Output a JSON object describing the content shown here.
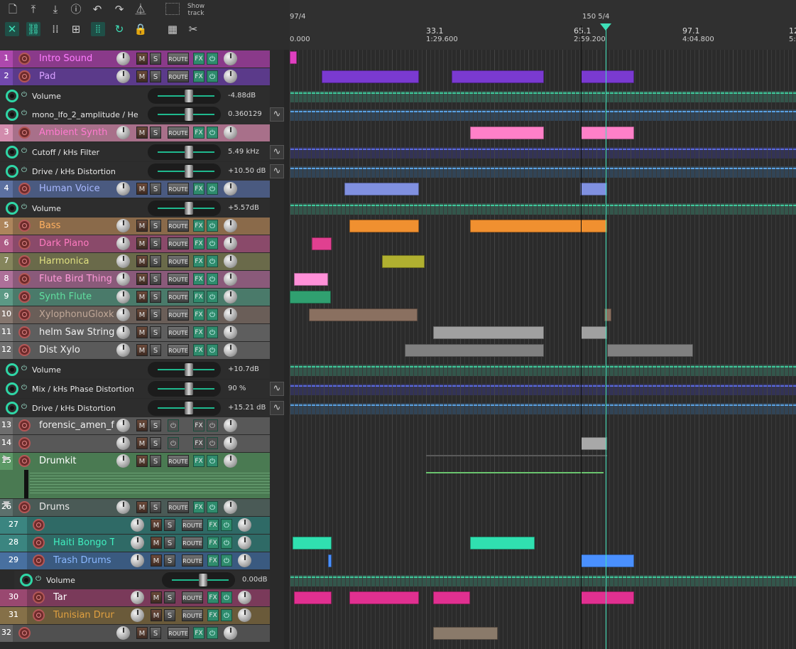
{
  "toolbar": {
    "show_track_label": "Show track",
    "icons": [
      "new-file",
      "save-upload",
      "download",
      "info",
      "undo",
      "redo",
      "metronome",
      "ripple",
      "link",
      "grid",
      "group",
      "grid-snap",
      "loop",
      "lock",
      "sequencer",
      "cut"
    ]
  },
  "ruler": {
    "start_label": "97/4",
    "start_time": "0.000",
    "markers": [
      {
        "bar": "33.1",
        "time": "1:29.600"
      },
      {
        "bar": "65.1",
        "time": "2:59.200"
      },
      {
        "bar": "97.1",
        "time": "4:04.800"
      },
      {
        "bar": "12",
        "time": "5:"
      }
    ],
    "tempo_marker": "150 5/4"
  },
  "buttons": {
    "mute": "M",
    "solo": "S",
    "route": "ROUTE",
    "fx": "FX",
    "power": "⏻"
  },
  "tracks": [
    {
      "num": "1",
      "name": "Intro Sound",
      "color": "#8a3a8a",
      "name_color": "#ff7dff"
    },
    {
      "num": "2",
      "name": "Pad",
      "color": "#5b3a8a",
      "name_color": "#d7a0ff"
    },
    {
      "num": "3",
      "name": "Ambient Synth",
      "color": "#a8708a",
      "name_color": "#ff7ad0"
    },
    {
      "num": "4",
      "name": "Human Voice",
      "color": "#4a5a80",
      "name_color": "#a8b8ff"
    },
    {
      "num": "5",
      "name": "Bass",
      "color": "#8a6a4a",
      "name_color": "#ffb060"
    },
    {
      "num": "6",
      "name": "Dark Piano",
      "color": "#8a4a6a",
      "name_color": "#ff7ac0"
    },
    {
      "num": "7",
      "name": "Harmonica",
      "color": "#6a6a4a",
      "name_color": "#e0e080"
    },
    {
      "num": "8",
      "name": "Flute Bird Thing",
      "color": "#8a5a7a",
      "name_color": "#ff9ad8"
    },
    {
      "num": "9",
      "name": "Synth Flute",
      "color": "#4a7a6a",
      "name_color": "#60e0a0"
    },
    {
      "num": "10",
      "name": "XylophonuGloxke",
      "color": "#6a5e58",
      "name_color": "#c0a898"
    },
    {
      "num": "11",
      "name": "helm Saw String",
      "color": "#5e5e5e",
      "name_color": "#f0f0f0"
    },
    {
      "num": "12",
      "name": "Dist Xylo",
      "color": "#5a5a5a",
      "name_color": "#f0f0f0"
    },
    {
      "num": "13",
      "name": "forensic_amen_fo",
      "color": "#585858",
      "name_color": "#f0f0f0"
    },
    {
      "num": "14",
      "name": "",
      "color": "#585858",
      "name_color": "#f0f0f0"
    },
    {
      "num": "15",
      "name": "Drumkit",
      "color": "#4a7a52",
      "name_color": "#ffffff"
    },
    {
      "num": "26",
      "name": "Drums",
      "color": "#4a5a56",
      "name_color": "#e8e8e8"
    },
    {
      "num": "27",
      "name": "",
      "color": "#2f6a66",
      "name_color": "#e8e8e8"
    },
    {
      "num": "28",
      "name": "Haiti Bongo Thing",
      "color": "#2f6a66",
      "name_color": "#40f0c0"
    },
    {
      "num": "29",
      "name": "Trash Drums",
      "color": "#3a5a80",
      "name_color": "#8ab8ff"
    },
    {
      "num": "30",
      "name": "Tar",
      "color": "#7a3a5a",
      "name_color": "#ffffff"
    },
    {
      "num": "31",
      "name": "Tunisian Drum",
      "color": "#6a5a3a",
      "name_color": "#e0a040"
    },
    {
      "num": "32",
      "name": "",
      "color": "#505050",
      "name_color": "#e8e8e8"
    }
  ],
  "envelopes": [
    {
      "name": "Volume",
      "value": "-4.88dB"
    },
    {
      "name": "mono_lfo_2_amplitude / He",
      "value": "0.360129"
    },
    {
      "name": "Cutoff / kHs Filter",
      "value": "5.49 kHz"
    },
    {
      "name": "Drive / kHs Distortion",
      "value": "+10.50 dB"
    },
    {
      "name": "Volume",
      "value": "+5.57dB"
    },
    {
      "name": "Volume",
      "value": "+10.7dB"
    },
    {
      "name": "Mix / kHs Phase Distortion",
      "value": "90 %"
    },
    {
      "name": "Drive / kHs Distortion",
      "value": "+15.21 dB"
    },
    {
      "name": "Volume",
      "value": "0.00dB"
    }
  ],
  "colors": {
    "accent": "#3ee0b8",
    "background": "#262626"
  }
}
